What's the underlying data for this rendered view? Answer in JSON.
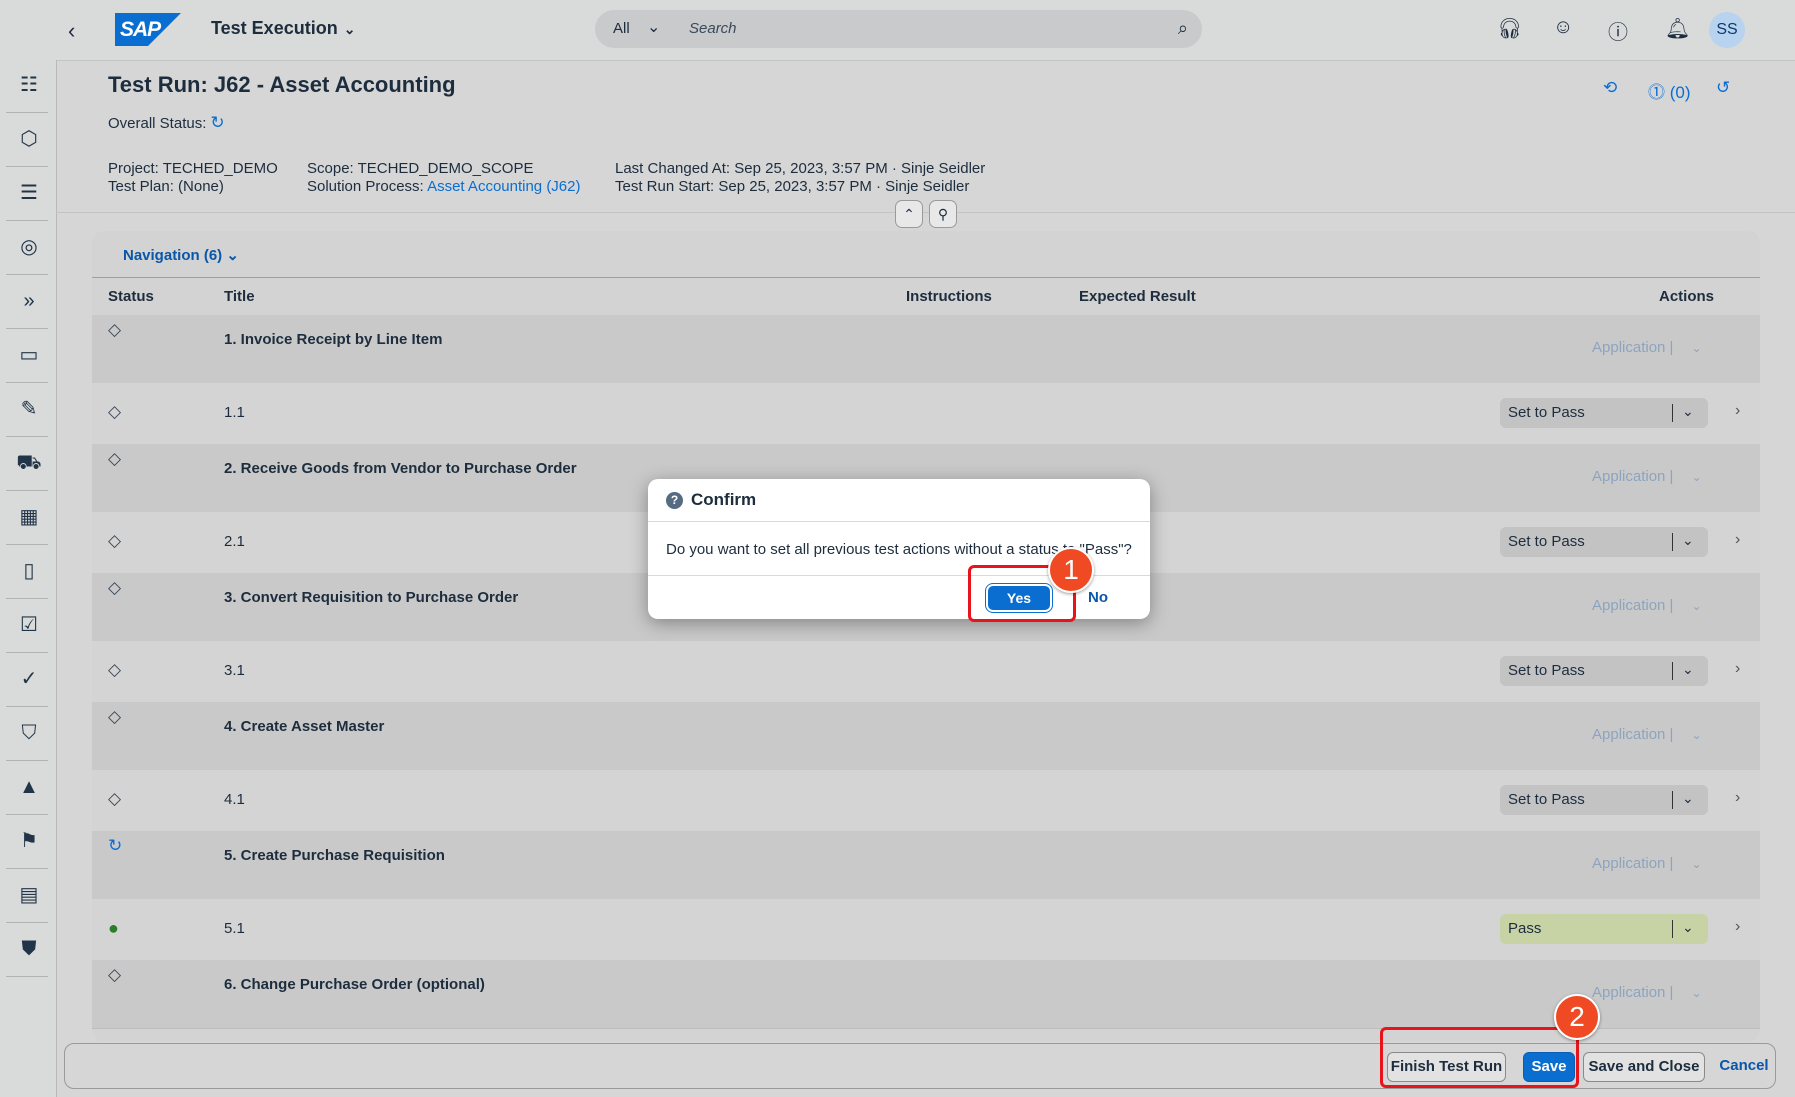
{
  "shell": {
    "back": "‹",
    "logo": "SAP",
    "app_title": "Test Execution",
    "search_scope": "All",
    "search_placeholder": "Search",
    "avatar": "SS"
  },
  "header": {
    "title": "Test Run: J62 - Asset Accounting",
    "overall_status_label": "Overall Status:",
    "issues": "(0)",
    "project": "Project: TECHED_DEMO",
    "test_plan": "Test Plan: (None)",
    "scope": "Scope: TECHED_DEMO_SCOPE",
    "solution_process_label": "Solution Process:",
    "solution_process_value": "Asset Accounting (J62)",
    "last_changed": "Last Changed At: Sep 25, 2023, 3:57 PM  · Sinje Seidler",
    "run_start": "Test Run Start: Sep 25, 2023, 3:57 PM  · Sinje Seidler"
  },
  "navigation": {
    "label": "Navigation (6)"
  },
  "table": {
    "headers": {
      "status": "Status",
      "title": "Title",
      "instructions": "Instructions",
      "expected": "Expected Result",
      "actions": "Actions"
    },
    "rows": [
      {
        "title": "1. Invoice Receipt by Line Item",
        "action": "Application"
      },
      {
        "title": "1.1",
        "action": "Set to Pass"
      },
      {
        "title": "2. Receive Goods from Vendor to Purchase Order",
        "action": "Application"
      },
      {
        "title": "2.1",
        "action": "Set to Pass"
      },
      {
        "title": "3. Convert Requisition to Purchase Order",
        "action": "Application"
      },
      {
        "title": "3.1",
        "action": "Set to Pass"
      },
      {
        "title": "4. Create Asset Master",
        "action": "Application"
      },
      {
        "title": "4.1",
        "action": "Set to Pass"
      },
      {
        "title": "5. Create Purchase Requisition",
        "action": "Application"
      },
      {
        "title": "5.1",
        "action": "Pass"
      },
      {
        "title": "6. Change Purchase Order (optional)",
        "action": "Application"
      }
    ]
  },
  "footer": {
    "finish": "Finish Test Run",
    "save": "Save",
    "save_close": "Save and Close",
    "cancel": "Cancel"
  },
  "dialog": {
    "title": "Confirm",
    "message": "Do you want to set all previous test actions without a status to \"Pass\"?",
    "yes": "Yes",
    "no": "No"
  },
  "callouts": {
    "one": "1",
    "two": "2"
  },
  "colors": {
    "accent": "#0a6ed1",
    "callout": "#ef4a24",
    "pass": "#2b7d2b"
  }
}
